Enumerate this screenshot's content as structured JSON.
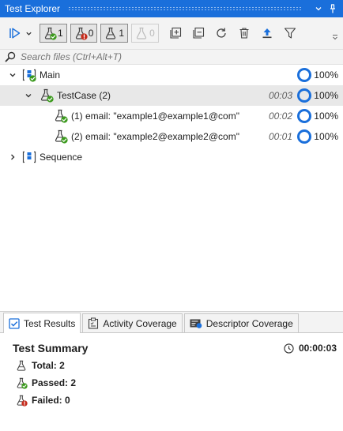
{
  "window": {
    "title": "Test Explorer"
  },
  "toolbar": {
    "passed_count": "1",
    "failed_count": "0",
    "not_run_count": "1",
    "skipped_count": "0"
  },
  "search": {
    "placeholder": "Search files (Ctrl+Alt+T)",
    "value": ""
  },
  "tree": {
    "rows": [
      {
        "label": "Main",
        "duration": "",
        "percent": "100%"
      },
      {
        "label": "TestCase (2)",
        "duration": "00:03",
        "percent": "100%"
      },
      {
        "label": "(1) email: \"example1@example1@com\"",
        "duration": "00:02",
        "percent": "100%"
      },
      {
        "label": "(2) email: \"example2@example2@com\"",
        "duration": "00:01",
        "percent": "100%"
      },
      {
        "label": "Sequence"
      }
    ]
  },
  "tabs": [
    {
      "label": "Test Results",
      "icon": "checkbox-icon"
    },
    {
      "label": "Activity Coverage",
      "icon": "clipboard-icon"
    },
    {
      "label": "Descriptor Coverage",
      "icon": "descriptor-icon"
    }
  ],
  "summary": {
    "title": "Test Summary",
    "time": "00:00:03",
    "total_label": "Total:",
    "total_value": "2",
    "passed_label": "Passed:",
    "passed_value": "2",
    "failed_label": "Failed:",
    "failed_value": "0"
  },
  "colors": {
    "accent": "#1a6fdb",
    "passed": "#3c9a1e",
    "failed": "#c42b1c"
  }
}
